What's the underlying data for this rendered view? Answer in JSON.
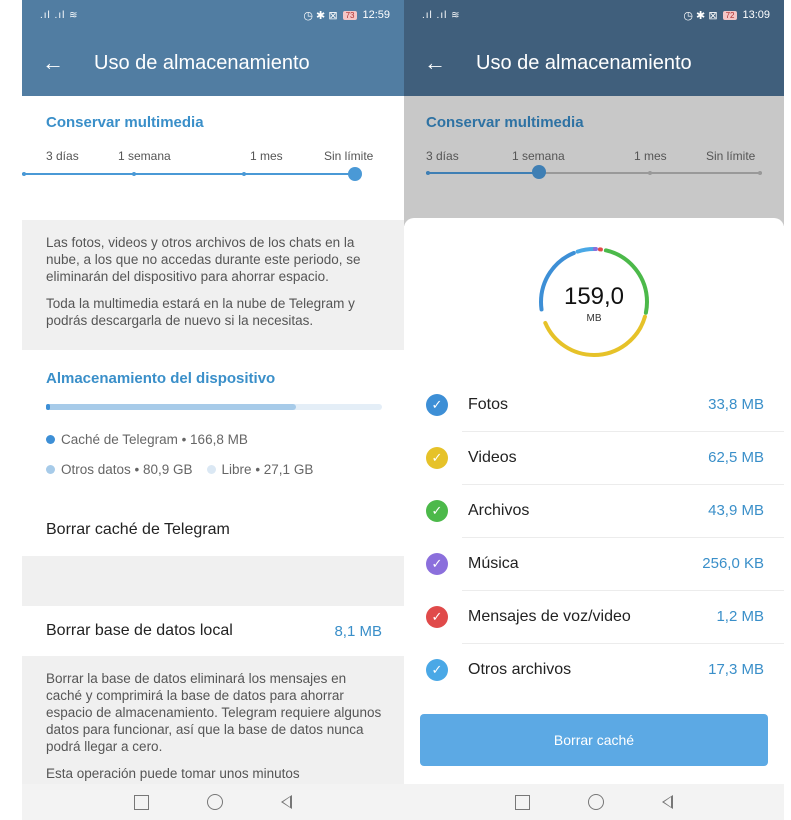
{
  "left": {
    "status": {
      "signal": ".ıl .ıl ≋",
      "icons": "◷ ✱ ⊠",
      "battery": "73",
      "time": "12:59"
    },
    "title": "Uso de almacenamiento",
    "keep_media": {
      "title": "Conservar multimedia",
      "options": [
        "3 días",
        "1 semana",
        "1 mes",
        "Sin límite"
      ],
      "selected_index": 3
    },
    "info_p1": "Las fotos, videos y otros archivos de los chats en la nube, a los que no accedas durante este periodo, se eliminarán del dispositivo para ahorrar espacio.",
    "info_p2": "Toda la multimedia estará en la nube de Telegram y podrás descargarla de nuevo si la necesitas.",
    "device": {
      "title": "Almacenamiento del dispositivo",
      "legend_cache": "Caché de Telegram • 166,8 MB",
      "legend_other": "Otros datos • 80,9 GB",
      "legend_free": "Libre • 27,1 GB"
    },
    "clear_cache_label": "Borrar caché de Telegram",
    "clear_db_label": "Borrar base de datos local",
    "clear_db_value": "8,1 MB",
    "db_info": "Borrar la base de datos eliminará los mensajes en caché y comprimirá la base de datos para ahorrar espacio de almacenamiento. Telegram requiere algunos datos para funcionar, así que la base de datos nunca podrá llegar a cero.",
    "db_info_cut": "Esta operación puede tomar unos minutos"
  },
  "right": {
    "status": {
      "signal": ".ıl .ıl ≋",
      "icons": "◷ ✱ ⊠",
      "battery": "72",
      "time": "13:09"
    },
    "title": "Uso de almacenamiento",
    "keep_media": {
      "title": "Conservar multimedia",
      "options": [
        "3 días",
        "1 semana",
        "1 mes",
        "Sin límite"
      ],
      "selected_index": 1
    },
    "total_value": "159,0",
    "total_unit": "MB",
    "items": [
      {
        "label": "Fotos",
        "value": "33,8 MB",
        "color": "#3d8fd6",
        "icon": "check-icon"
      },
      {
        "label": "Videos",
        "value": "62,5 MB",
        "color": "#e6c229",
        "icon": "check-icon"
      },
      {
        "label": "Archivos",
        "value": "43,9 MB",
        "color": "#4cb94a",
        "icon": "check-icon"
      },
      {
        "label": "Música",
        "value": "256,0 KB",
        "color": "#8b6fdc",
        "icon": "check-icon"
      },
      {
        "label": "Mensajes de voz/video",
        "value": "1,2 MB",
        "color": "#e04a4a",
        "icon": "check-icon"
      },
      {
        "label": "Otros archivos",
        "value": "17,3 MB",
        "color": "#4aa8e6",
        "icon": "check-icon"
      }
    ],
    "clear_button": "Borrar caché"
  },
  "colors": {
    "header": "#517da2",
    "accent": "#3a8fc9",
    "button": "#5ca9e4"
  }
}
